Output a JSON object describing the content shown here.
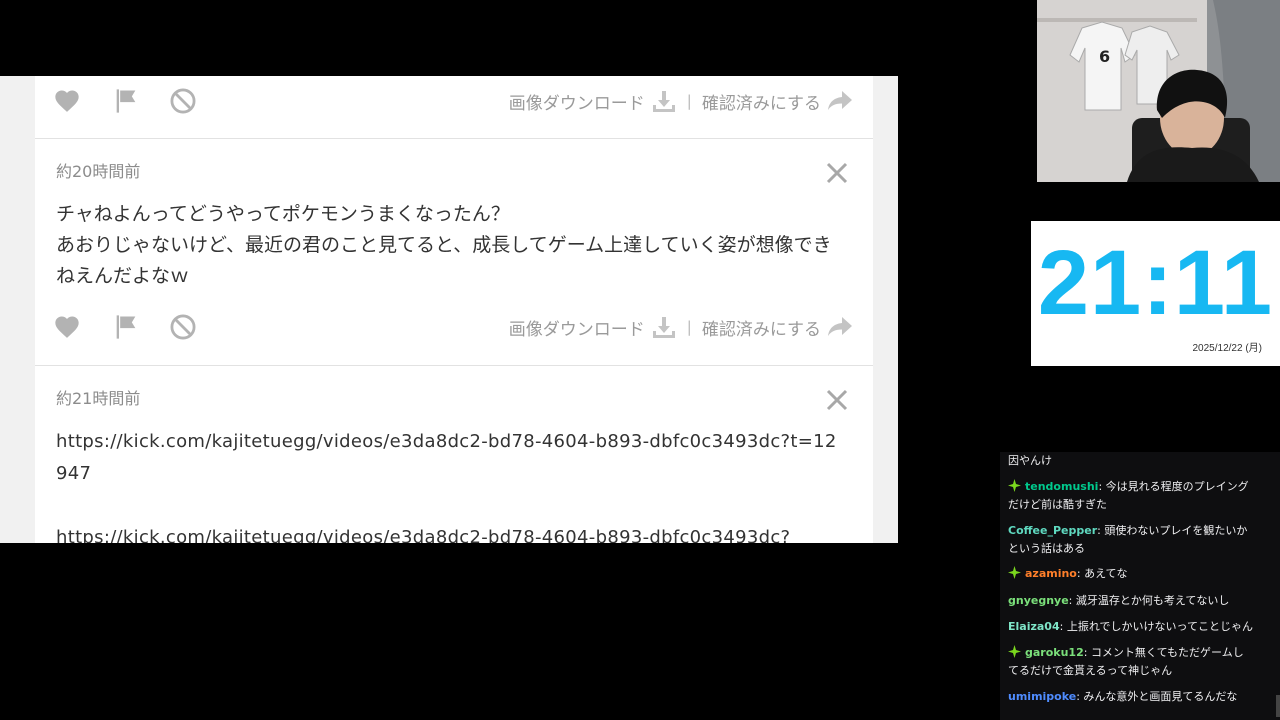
{
  "question_box": {
    "cards": [
      {
        "actions": {
          "download_label": "画像ダウンロード",
          "separator": "|",
          "confirm_label": "確認済みにする"
        }
      },
      {
        "time": "約20時間前",
        "message": "チャねよんってどうやってポケモンうまくなったん？\nあおりじゃないけど、最近の君のこと見てると、成長してゲーム上達していく姿が想像できねえんだよなｗ",
        "actions": {
          "download_label": "画像ダウンロード",
          "separator": "|",
          "confirm_label": "確認済みにする"
        }
      },
      {
        "time": "約21時間前",
        "message": "https://kick.com/kajitetuegg/videos/e3da8dc2-bd78-4604-b893-dbfc0c3493dc?t=12947\n\nhttps://kick.com/kajitetuegg/videos/e3da8dc2-bd78-4604-b893-dbfc0c3493dc?"
      }
    ]
  },
  "clock": {
    "time": "21:11",
    "date": "2025/12/22 (月)"
  },
  "chat": {
    "messages": [
      {
        "user": "",
        "text": "因やんけ",
        "badge": false
      },
      {
        "user": "tendomushi",
        "text": "今は見れる程度のプレイングだけど前は酷すぎた",
        "badge": true,
        "color": "#00c98d"
      },
      {
        "user": "Coffee_Pepper",
        "text": "頭使わないプレイを観たいかという話はある",
        "badge": false,
        "color": "#5fd9c0"
      },
      {
        "user": "azamino",
        "text": "あえてな",
        "badge": true,
        "color": "#ff7f2a"
      },
      {
        "user": "gnyegnye",
        "text": "滅牙温存とか何も考えてないし",
        "badge": false,
        "color": "#7be07b"
      },
      {
        "user": "Elaiza04",
        "text": "上振れでしかいけないってことじゃん",
        "badge": false,
        "color": "#7fe5c8"
      },
      {
        "user": "garoku12",
        "text": "コメント無くてもただゲームしてるだけで金貰えるって神じゃん",
        "badge": true,
        "color": "#7be07b"
      },
      {
        "user": "umimipoke",
        "text": "みんな意外と画面見てるんだな",
        "badge": false,
        "color": "#4f8cff"
      }
    ]
  },
  "colors": {
    "clock": "#17b8f2",
    "icon_gray": "#b3b3b3",
    "badge_green": "#7bd81e"
  },
  "icons": [
    "heart-icon",
    "flag-icon",
    "block-icon",
    "download-icon",
    "share-icon",
    "close-icon",
    "sparkle-badge-icon"
  ]
}
